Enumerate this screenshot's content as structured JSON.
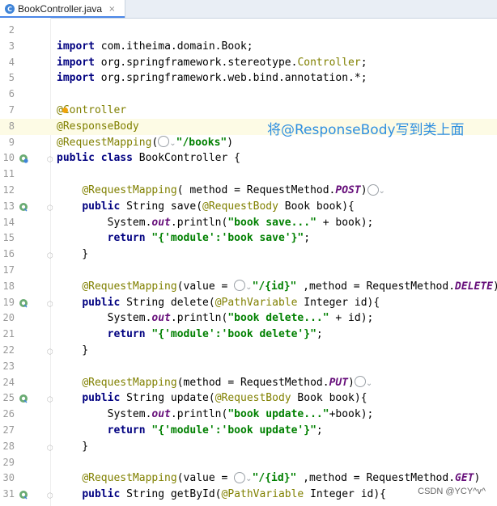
{
  "tab": {
    "title": "BookController.java",
    "icon": "java-class-icon",
    "close": "×"
  },
  "overlay_text": "将@ResponseBody写到类上面",
  "watermark": "CSDN @YCY^v^",
  "colors": {
    "keyword": "#000080",
    "annotation": "#808000",
    "string": "#008000",
    "static_field": "#660e7a",
    "overlay": "#2f8fe0"
  },
  "lines": [
    {
      "n": "2",
      "segs": []
    },
    {
      "n": "3",
      "segs": [
        [
          "kw",
          "import "
        ],
        [
          "",
          "com.itheima.domain.Book;"
        ]
      ]
    },
    {
      "n": "4",
      "segs": [
        [
          "kw",
          "import "
        ],
        [
          "",
          "org.springframework.stereotype."
        ],
        [
          "cls",
          "Controller"
        ],
        [
          "",
          ";"
        ]
      ]
    },
    {
      "n": "5",
      "segs": [
        [
          "kw",
          "import "
        ],
        [
          "",
          "org.springframework.web.bind.annotation.*;"
        ]
      ]
    },
    {
      "n": "6",
      "segs": []
    },
    {
      "n": "7",
      "segs": [
        [
          "ann",
          "@Controller"
        ]
      ]
    },
    {
      "n": "8",
      "segs": [
        [
          "ann",
          "@ResponseBody"
        ]
      ]
    },
    {
      "n": "9",
      "segs": [
        [
          "ann",
          "@RequestMapping"
        ],
        [
          "",
          "("
        ],
        [
          "globe",
          ""
        ],
        [
          "chev",
          "⌄"
        ],
        [
          "str",
          "\"/books\""
        ],
        [
          "",
          ")"
        ]
      ]
    },
    {
      "n": "10",
      "segs": [
        [
          "kw",
          "public class "
        ],
        [
          "",
          "BookController {"
        ]
      ]
    },
    {
      "n": "11",
      "segs": []
    },
    {
      "n": "12",
      "segs": [
        [
          "",
          "    "
        ],
        [
          "ann",
          "@RequestMapping"
        ],
        [
          "",
          "( method = RequestMethod."
        ],
        [
          "ital",
          "POST"
        ],
        [
          "",
          ")"
        ],
        [
          "globe",
          ""
        ],
        [
          "chev",
          "⌄"
        ]
      ]
    },
    {
      "n": "13",
      "segs": [
        [
          "",
          "    "
        ],
        [
          "kw",
          "public "
        ],
        [
          "",
          "String save("
        ],
        [
          "ann",
          "@RequestBody"
        ],
        [
          "",
          " Book book){"
        ]
      ]
    },
    {
      "n": "14",
      "segs": [
        [
          "",
          "        System."
        ],
        [
          "ital",
          "out"
        ],
        [
          "",
          ".println("
        ],
        [
          "str",
          "\"book save...\""
        ],
        [
          "",
          " + book);"
        ]
      ]
    },
    {
      "n": "15",
      "segs": [
        [
          "",
          "        "
        ],
        [
          "kw",
          "return "
        ],
        [
          "str",
          "\"{'module':'book save'}\""
        ],
        [
          "",
          ";"
        ]
      ]
    },
    {
      "n": "16",
      "segs": [
        [
          "",
          "    }"
        ]
      ]
    },
    {
      "n": "17",
      "segs": []
    },
    {
      "n": "18",
      "segs": [
        [
          "",
          "    "
        ],
        [
          "ann",
          "@RequestMapping"
        ],
        [
          "",
          "(value = "
        ],
        [
          "globe",
          ""
        ],
        [
          "chev",
          "⌄"
        ],
        [
          "str",
          "\"/{id}\""
        ],
        [
          "",
          " ,method = RequestMethod."
        ],
        [
          "ital",
          "DELETE"
        ],
        [
          "",
          ")"
        ]
      ]
    },
    {
      "n": "19",
      "segs": [
        [
          "",
          "    "
        ],
        [
          "kw",
          "public "
        ],
        [
          "",
          "String delete("
        ],
        [
          "ann",
          "@PathVariable"
        ],
        [
          "",
          " Integer id){"
        ]
      ]
    },
    {
      "n": "20",
      "segs": [
        [
          "",
          "        System."
        ],
        [
          "ital",
          "out"
        ],
        [
          "",
          ".println("
        ],
        [
          "str",
          "\"book delete...\""
        ],
        [
          "",
          " + id);"
        ]
      ]
    },
    {
      "n": "21",
      "segs": [
        [
          "",
          "        "
        ],
        [
          "kw",
          "return "
        ],
        [
          "str",
          "\"{'module':'book delete'}\""
        ],
        [
          "",
          ";"
        ]
      ]
    },
    {
      "n": "22",
      "segs": [
        [
          "",
          "    }"
        ]
      ]
    },
    {
      "n": "23",
      "segs": []
    },
    {
      "n": "24",
      "segs": [
        [
          "",
          "    "
        ],
        [
          "ann",
          "@RequestMapping"
        ],
        [
          "",
          "(method = RequestMethod."
        ],
        [
          "ital",
          "PUT"
        ],
        [
          "",
          ")"
        ],
        [
          "globe",
          ""
        ],
        [
          "chev",
          "⌄"
        ]
      ]
    },
    {
      "n": "25",
      "segs": [
        [
          "",
          "    "
        ],
        [
          "kw",
          "public "
        ],
        [
          "",
          "String update("
        ],
        [
          "ann",
          "@RequestBody"
        ],
        [
          "",
          " Book book){"
        ]
      ]
    },
    {
      "n": "26",
      "segs": [
        [
          "",
          "        System."
        ],
        [
          "ital",
          "out"
        ],
        [
          "",
          ".println("
        ],
        [
          "str",
          "\"book update...\""
        ],
        [
          "",
          "+book);"
        ]
      ]
    },
    {
      "n": "27",
      "segs": [
        [
          "",
          "        "
        ],
        [
          "kw",
          "return "
        ],
        [
          "str",
          "\"{'module':'book update'}\""
        ],
        [
          "",
          ";"
        ]
      ]
    },
    {
      "n": "28",
      "segs": [
        [
          "",
          "    }"
        ]
      ]
    },
    {
      "n": "29",
      "segs": []
    },
    {
      "n": "30",
      "segs": [
        [
          "",
          "    "
        ],
        [
          "ann",
          "@RequestMapping"
        ],
        [
          "",
          "(value = "
        ],
        [
          "globe",
          ""
        ],
        [
          "chev",
          "⌄"
        ],
        [
          "str",
          "\"/{id}\""
        ],
        [
          "",
          " ,method = RequestMethod."
        ],
        [
          "ital",
          "GET"
        ],
        [
          "",
          ")"
        ]
      ]
    },
    {
      "n": "31",
      "segs": [
        [
          "",
          "    "
        ],
        [
          "kw",
          "public "
        ],
        [
          "",
          "String getById("
        ],
        [
          "ann",
          "@PathVariable"
        ],
        [
          "",
          " Integer id){"
        ]
      ]
    }
  ],
  "gutter_icons": {
    "10": "spring-bean-icon",
    "13": "spring-endpoint-icon",
    "19": "spring-endpoint-icon",
    "25": "spring-endpoint-icon",
    "31": "spring-endpoint-icon"
  },
  "fold_lines": [
    "10",
    "13",
    "16",
    "19",
    "22",
    "25",
    "28",
    "31"
  ],
  "current_line": "8"
}
